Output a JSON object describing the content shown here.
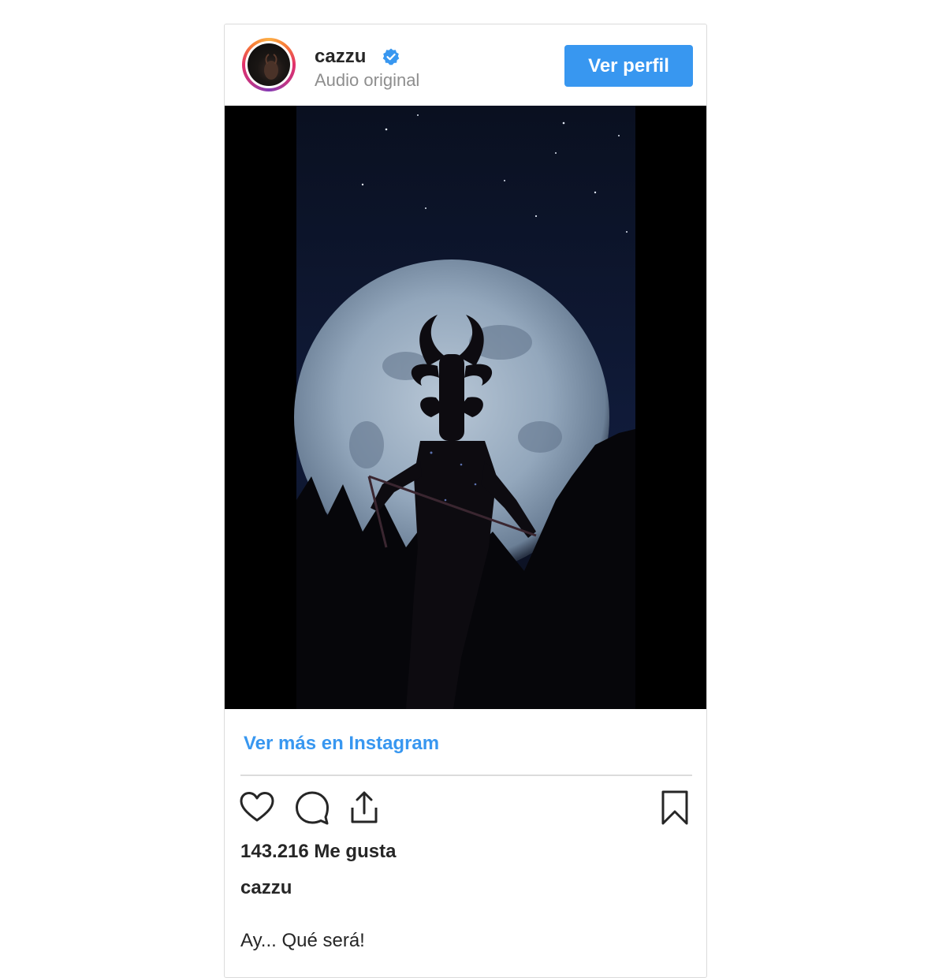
{
  "post": {
    "username": "cazzu",
    "subtitle": "Audio original",
    "profile_button": "Ver perfil",
    "more_link": "Ver más en Instagram",
    "likes": "143.216 Me gusta",
    "caption_user": "cazzu",
    "caption": "Ay... Qué será!"
  },
  "icons": {
    "verified": "verified-badge-icon",
    "like": "heart-icon",
    "comment": "comment-icon",
    "share": "share-icon",
    "save": "bookmark-icon"
  },
  "colors": {
    "accent": "#3897f0",
    "text": "#262626",
    "muted": "#8e8e8e",
    "border": "#dbdbdb"
  }
}
